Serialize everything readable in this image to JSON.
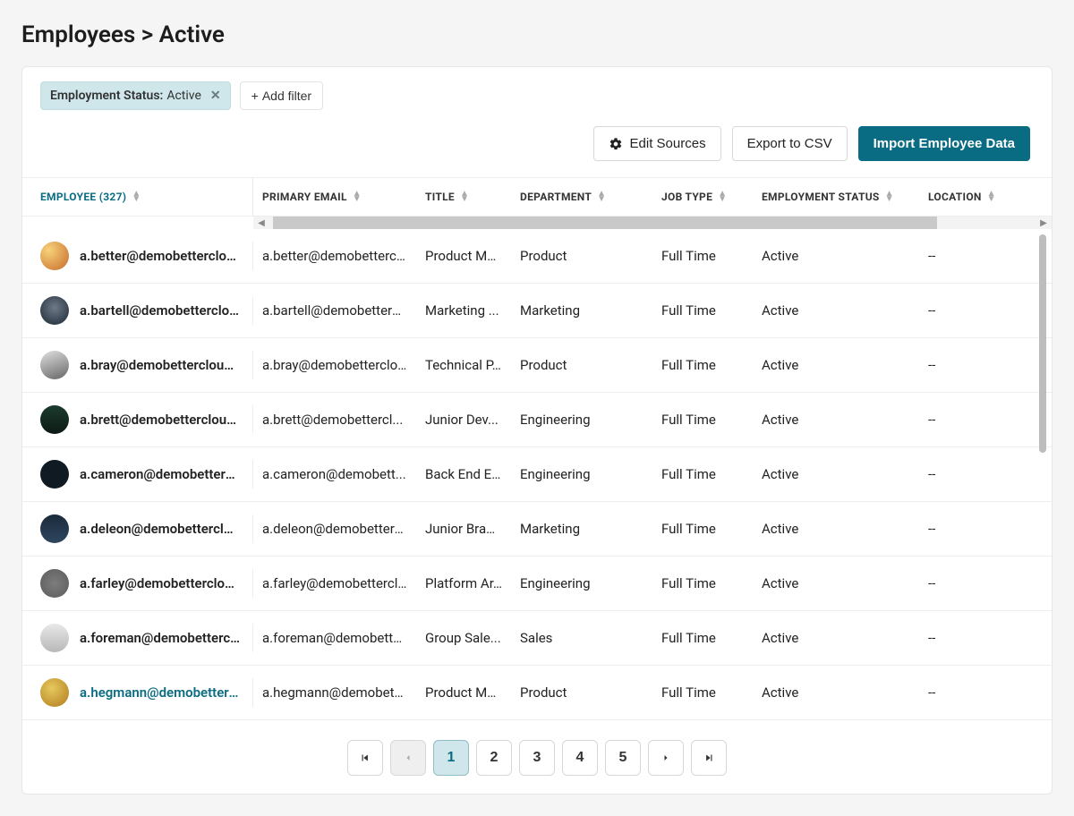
{
  "breadcrumb": {
    "root": "Employees",
    "sep": ">",
    "current": "Active"
  },
  "filter": {
    "label": "Employment Status:",
    "value": "Active",
    "close": "✕",
    "add_label": "Add filter"
  },
  "actions": {
    "edit_sources": "Edit Sources",
    "export_csv": "Export to CSV",
    "import": "Import Employee Data"
  },
  "table": {
    "columns": {
      "employee": "EMPLOYEE (327)",
      "primary_email": "PRIMARY EMAIL",
      "title": "TITLE",
      "department": "DEPARTMENT",
      "job_type": "JOB TYPE",
      "employment_status": "EMPLOYMENT STATUS",
      "location": "LOCATION"
    },
    "rows": [
      {
        "employee": "a.better@demobettercloud...",
        "email": "a.better@demobettercl...",
        "title": "Product Ma...",
        "department": "Product",
        "job_type": "Full Time",
        "status": "Active",
        "location": "--"
      },
      {
        "employee": "a.bartell@demobettercloud...",
        "email": "a.bartell@demobetterc...",
        "title": "Marketing ...",
        "department": "Marketing",
        "job_type": "Full Time",
        "status": "Active",
        "location": "--"
      },
      {
        "employee": "a.bray@demobettercloud....",
        "email": "a.bray@demobetterclo...",
        "title": "Technical P...",
        "department": "Product",
        "job_type": "Full Time",
        "status": "Active",
        "location": "--"
      },
      {
        "employee": "a.brett@demobettercloud....",
        "email": "a.brett@demobettercl...",
        "title": "Junior Dev...",
        "department": "Engineering",
        "job_type": "Full Time",
        "status": "Active",
        "location": "--"
      },
      {
        "employee": "a.cameron@demobettercl...",
        "email": "a.cameron@demobett...",
        "title": "Back End E...",
        "department": "Engineering",
        "job_type": "Full Time",
        "status": "Active",
        "location": "--"
      },
      {
        "employee": "a.deleon@demobetterclou...",
        "email": "a.deleon@demobettercl...",
        "title": "Junior Bran...",
        "department": "Marketing",
        "job_type": "Full Time",
        "status": "Active",
        "location": "--"
      },
      {
        "employee": "a.farley@demobettercloud...",
        "email": "a.farley@demobettercl...",
        "title": "Platform Ar...",
        "department": "Engineering",
        "job_type": "Full Time",
        "status": "Active",
        "location": "--"
      },
      {
        "employee": "a.foreman@demobetterclo...",
        "email": "a.foreman@demobette...",
        "title": "Group Sale...",
        "department": "Sales",
        "job_type": "Full Time",
        "status": "Active",
        "location": "--"
      },
      {
        "employee": "a.hegmann@demobettercl...",
        "email": "a.hegmann@demobett...",
        "title": "Product Ma...",
        "department": "Product",
        "job_type": "Full Time",
        "status": "Active",
        "location": "--"
      }
    ]
  },
  "pagination": {
    "first": "I❮",
    "prev": "❮",
    "pages": [
      "1",
      "2",
      "3",
      "4",
      "5"
    ],
    "active": "1",
    "next": "❯",
    "last": "❯I"
  }
}
